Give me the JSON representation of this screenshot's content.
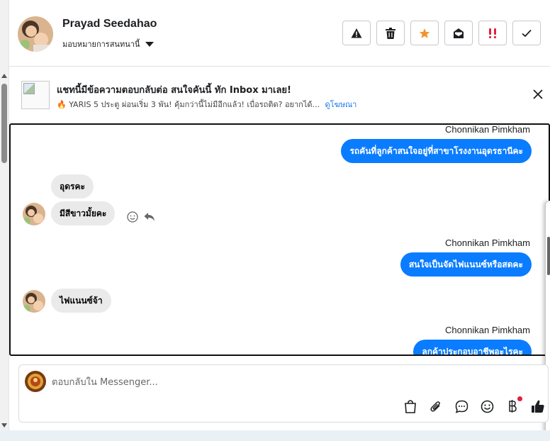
{
  "header": {
    "contact_name": "Prayad Seedahao",
    "assign_label": "มอบหมายการสนทนานี้",
    "actions": [
      {
        "name": "spam-button",
        "icon": "warning-icon"
      },
      {
        "name": "delete-button",
        "icon": "trash-icon"
      },
      {
        "name": "star-button",
        "icon": "star-icon",
        "color": "#f0932b"
      },
      {
        "name": "mark-unread-button",
        "icon": "envelope-open-icon"
      },
      {
        "name": "follow-up-button",
        "icon": "exclamation-icon",
        "color": "#e41e3f"
      },
      {
        "name": "done-button",
        "icon": "check-icon"
      }
    ]
  },
  "ad": {
    "title": "แชทนี้มีข้อความตอบกลับต่อ สนใจคันนี้ ทัก Inbox มาเลย!",
    "subtitle": "🔥 YARIS 5 ประตู ผ่อนเริ่ม 3 พัน! คุ้มกว่านี้ไม่มีอีกแล้ว! เบื่อรถติด? อยากได้...",
    "link": "ดูโฆษณา"
  },
  "messages": [
    {
      "sender": "Chonnikan Pimkham",
      "text": "รถคันที่ลูกค้าสนใจอยู่ที่สาขาโรงงานอุดรธานีคะ"
    },
    {
      "text": "อุดรคะ"
    },
    {
      "text": "มีสีขาวมั้ยคะ"
    },
    {
      "sender": "Chonnikan Pimkham",
      "text": "สนใจเป็นจัดไฟแนนซ์หรือสดคะ"
    },
    {
      "text": "ไฟแนนซ์จ้า"
    },
    {
      "sender": "Chonnikan Pimkham",
      "text": "ลูกค้าประกอบอาชีพอะไรคะ"
    }
  ],
  "composer": {
    "placeholder": "ตอบกลับใน Messenger..."
  },
  "colors": {
    "outgoing_bubble": "#0a7cff",
    "incoming_bubble": "#eaeaea",
    "notification_dot": "#e41e3f"
  }
}
